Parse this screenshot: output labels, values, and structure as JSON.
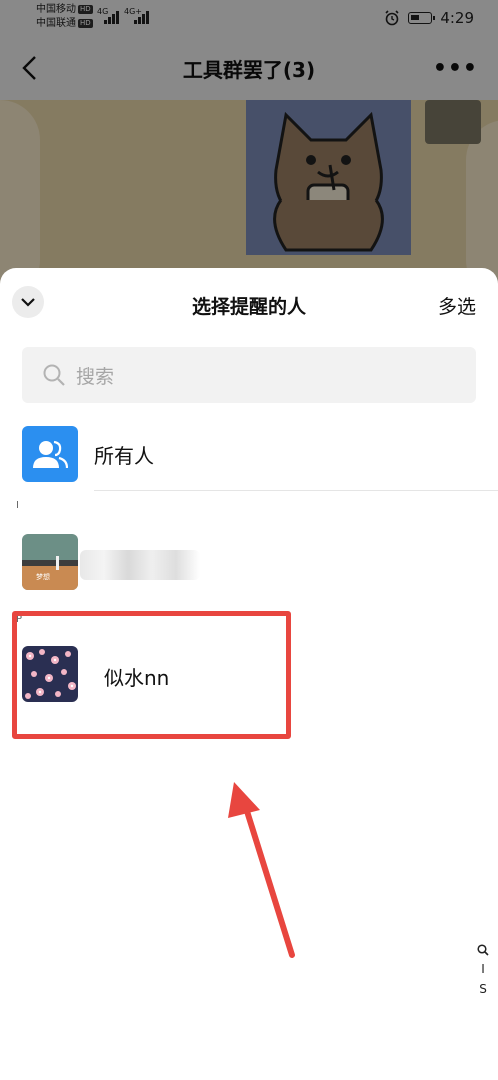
{
  "status_bar": {
    "carrier_1": "中国移动",
    "carrier_2": "中国联通",
    "hd_label": "HD",
    "network_1": "4G",
    "network_2": "4G+",
    "time": "4:29"
  },
  "nav": {
    "title": "工具群罢了(3)",
    "more": "•••"
  },
  "sheet": {
    "title": "选择提醒的人",
    "multi_select_label": "多选",
    "search": {
      "placeholder": "搜索"
    },
    "everyone_label": "所有人",
    "sections": [
      {
        "letter": "I",
        "contacts": [
          {
            "name": "",
            "avatar_caption": "梦想"
          }
        ]
      },
      {
        "letter": "P",
        "contacts": [
          {
            "name": "似水nn"
          }
        ]
      }
    ],
    "index_bar": [
      "🔍",
      "I",
      "S"
    ]
  },
  "annotation": {
    "highlight_color": "#e8463f"
  },
  "colors": {
    "accent_blue": "#2b8ff0",
    "highlight_red": "#e8463f"
  }
}
